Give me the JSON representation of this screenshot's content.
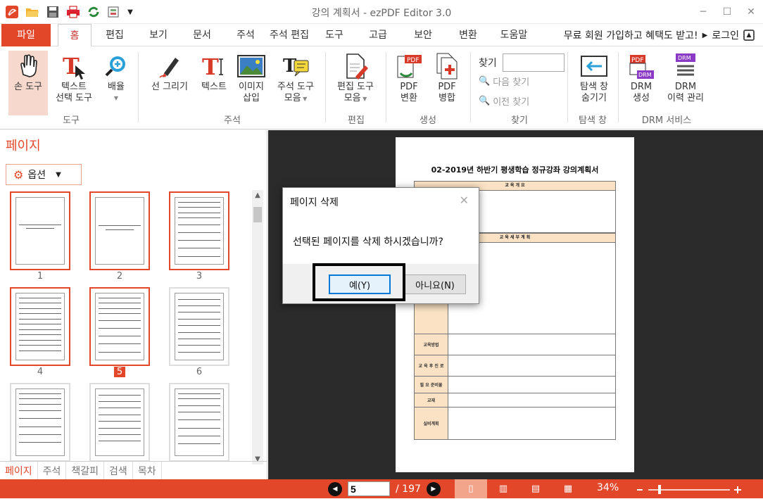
{
  "window": {
    "title": "강의 계획서 - ezPDF Editor 3.0",
    "controls": [
      "─",
      "☐",
      "✕"
    ]
  },
  "menu": {
    "tabs": [
      "파일",
      "홈",
      "편집",
      "보기",
      "문서",
      "주석",
      "주석 편집",
      "도구",
      "고급",
      "보안",
      "변환",
      "도움말"
    ],
    "promo": "무료 회원 가입하고 혜택도 받고!",
    "login": "로그인"
  },
  "ribbon": {
    "hand_tool": "손 도구",
    "text_select_1": "텍스트",
    "text_select_2": "선택 도구",
    "zoom_1": "배율",
    "draw_line": "선 그리기",
    "text": "텍스트",
    "image_1": "이미지",
    "image_2": "삽입",
    "annot_1": "주석 도구",
    "annot_2": "모음",
    "edit_1": "편집 도구",
    "edit_2": "모음",
    "pdf_convert_1": "PDF",
    "pdf_convert_2": "변환",
    "pdf_merge_1": "PDF",
    "pdf_merge_2": "병합",
    "find_label": "찾기",
    "find_placeholder": "",
    "find_next": "다음 찾기",
    "find_prev": "이전 찾기",
    "nav_1": "탐색 창",
    "nav_2": "숨기기",
    "drm_create_1": "DRM",
    "drm_create_2": "생성",
    "drm_history_1": "DRM",
    "drm_history_2": "이력 관리",
    "groups": {
      "tools": "도구",
      "annot": "주석",
      "edit": "편집",
      "create": "생성",
      "find": "찾기",
      "nav": "탐색 창",
      "drm": "DRM 서비스"
    }
  },
  "left_panel": {
    "title": "페이지",
    "options": "옵션",
    "thumbs": [
      "1",
      "2",
      "3",
      "4",
      "5",
      "6",
      "",
      "",
      ""
    ],
    "tabs": [
      "페이지",
      "주석",
      "책갈피",
      "검색",
      "목차"
    ]
  },
  "document": {
    "title": "02-2019년 하반기 평생학습 정규강좌 강의계획서",
    "sections": [
      "교 육 개 요",
      "교 육 세 부 계 획"
    ],
    "rows": [
      "교육방법",
      "교 육 후 진 로",
      "필 요 준비물",
      "교재",
      "실비계획"
    ]
  },
  "dialog": {
    "title": "페이지 삭제",
    "message": "선택된 페이지를 삭제 하시겠습니까?",
    "yes": "예(Y)",
    "no": "아니요(N)"
  },
  "status": {
    "current_page": "5",
    "total_pages": "/ 197",
    "zoom": "34%"
  }
}
